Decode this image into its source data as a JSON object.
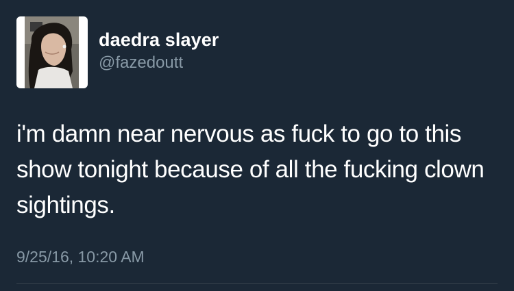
{
  "tweet": {
    "user": {
      "display_name": "daedra slayer",
      "handle": "@fazedoutt",
      "avatar_icon": "profile-photo"
    },
    "text": "i'm damn near nervous as fuck to go to this show tonight because of all the fucking clown sightings.",
    "timestamp": "9/25/16, 10:20 AM"
  },
  "colors": {
    "background": "#1b2836",
    "text_primary": "#ffffff",
    "text_secondary": "#8899a6"
  }
}
